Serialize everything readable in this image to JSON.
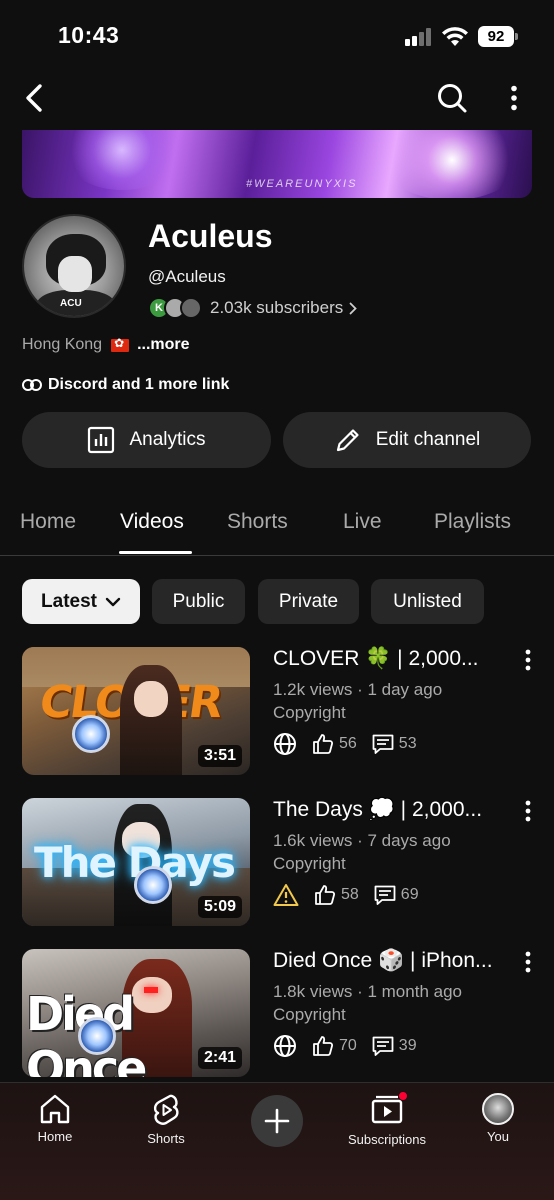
{
  "status_bar": {
    "time": "10:43",
    "battery": "92"
  },
  "channel": {
    "name": "Aculeus",
    "handle": "@Aculeus",
    "subscribers": "2.03k subscribers",
    "sub_avatar_letter": "K",
    "location": "Hong Kong",
    "more_label": "...more",
    "links_label": "Discord and 1 more link",
    "banner_tag": "#WEAREUNYXIS",
    "avatar_text": "ACU"
  },
  "actions": {
    "analytics": "Analytics",
    "edit_channel": "Edit channel"
  },
  "tabs": [
    {
      "label": "Home"
    },
    {
      "label": "Videos"
    },
    {
      "label": "Shorts"
    },
    {
      "label": "Live"
    },
    {
      "label": "Playlists"
    }
  ],
  "chips": [
    {
      "label": "Latest"
    },
    {
      "label": "Public"
    },
    {
      "label": "Private"
    },
    {
      "label": "Unlisted"
    }
  ],
  "videos": [
    {
      "title": "CLOVER 🍀 | 2,000...",
      "meta": "1.2k views · 1 day ago",
      "copyright": "Copyright",
      "likes": "56",
      "comments": "53",
      "duration": "3:51",
      "thumb_word": "CLOVER",
      "visibility": "public"
    },
    {
      "title": "The Days 💭 | 2,000...",
      "meta": "1.6k views · 7 days ago",
      "copyright": "Copyright",
      "likes": "58",
      "comments": "69",
      "duration": "5:09",
      "thumb_word": "The Days",
      "visibility": "warning"
    },
    {
      "title": "Died Once 🎲 | iPhon...",
      "meta": "1.8k views · 1 month ago",
      "copyright": "Copyright",
      "likes": "70",
      "comments": "39",
      "duration": "2:41",
      "thumb_word": "Died Once",
      "visibility": "public"
    }
  ],
  "bottom_nav": {
    "home": "Home",
    "shorts": "Shorts",
    "subscriptions": "Subscriptions",
    "you": "You"
  },
  "icons": {
    "back": "chevron-left-icon",
    "search": "search-icon",
    "more": "more-vert-icon",
    "link": "link-icon",
    "analytics": "analytics-icon",
    "edit": "pencil-icon",
    "globe": "globe-icon",
    "warning": "warning-icon",
    "like": "thumbs-up-icon",
    "comment": "comment-icon"
  },
  "colors": {
    "background": "#0f0f0f",
    "chip_bg": "#272727",
    "warning": "#f2c94c",
    "accent_red": "#ff0033"
  }
}
